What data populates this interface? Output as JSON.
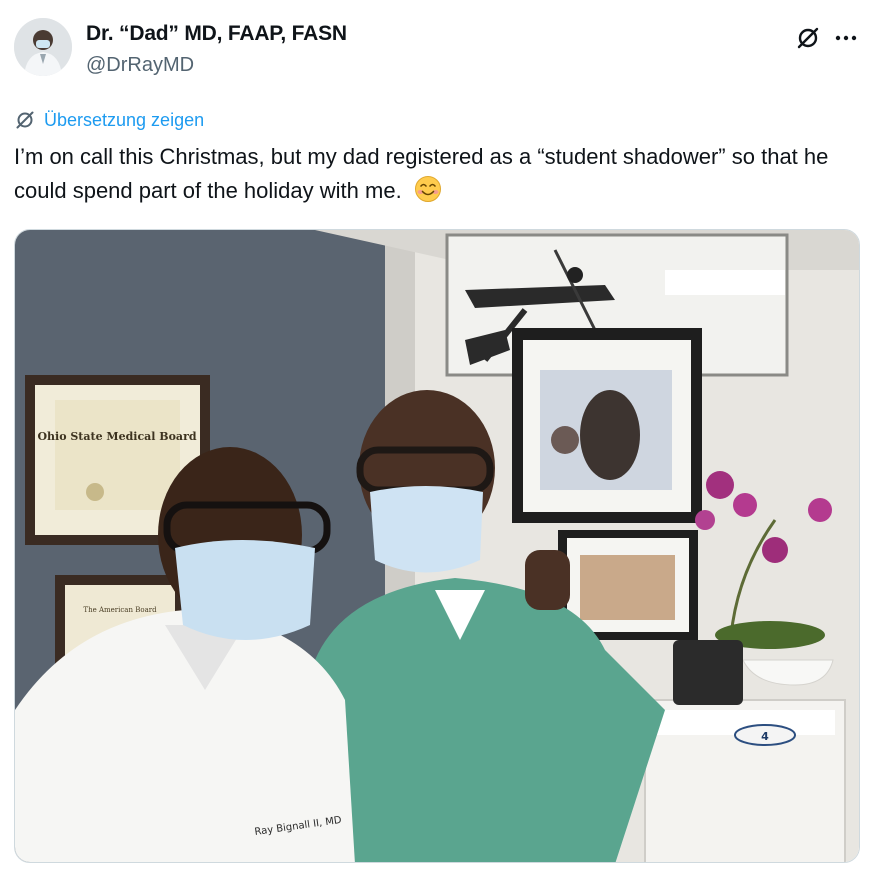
{
  "author": {
    "display_name": "Dr. “Dad” MD, FAAP, FASN",
    "handle": "@DrRayMD",
    "avatar_icon": "person-photo-icon"
  },
  "header_icons": [
    "grok-icon",
    "more-options-icon"
  ],
  "translate": {
    "icon": "translate-icon",
    "label": "Übersetzung zeigen",
    "color": "#1d9bf0"
  },
  "tweet": {
    "text": "I’m on call this Christmas, but my dad registered as a “student shadower” so that he could spend part of the holiday with me.",
    "emoji": "smiling-face-icon"
  },
  "media": {
    "type": "photo",
    "embedded_text": [
      "Ohio State Medical Board",
      "The American Board",
      "Ray Bignall II, MD",
      "4"
    ]
  }
}
